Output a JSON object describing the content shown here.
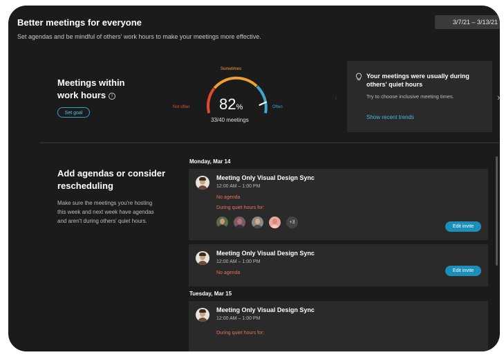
{
  "header": {
    "title": "Better meetings for everyone",
    "subtitle": "Set agendas and be mindful of others' work hours to make your meetings more effective.",
    "date_range": "3/7/21 – 3/13/21"
  },
  "work_hours": {
    "title": "Meetings within work hours",
    "info_icon": "info-icon",
    "set_goal_label": "Set goal",
    "gauge": {
      "percent_value": "82",
      "percent_sign": "%",
      "count_label": "33/40 meetings",
      "label_sometimes": "Sometimes",
      "label_not_often": "Not often",
      "label_often": "Often",
      "value_fraction": 0.825,
      "colors": {
        "not_often": "#e04a2a",
        "sometimes": "#f0a030",
        "often": "#3aa8cc"
      }
    }
  },
  "insight": {
    "title": "Your meetings were usually during others' quiet hours",
    "body": "Try to choose inclusive meeting times.",
    "link": "Show recent trends"
  },
  "agendas": {
    "title": "Add agendas or consider rescheduling",
    "body": "Make sure the meetings you're hosting this week and next week have agendas and aren't during others' quiet hours."
  },
  "days": [
    {
      "label": "Monday, Mar 14",
      "meetings": [
        {
          "title": "Meeting Only Visual Design Sync",
          "time": "12:00 AM – 1:00 PM",
          "warning_agenda": "No agenda",
          "warning_quiet": "During quiet hours for:",
          "more_attendees": "+3",
          "edit_label": "Edit invite"
        },
        {
          "title": "Meeting Only Visual Design Sync",
          "time": "12:00 AM – 1:00 PM",
          "warning_agenda": "No agenda",
          "edit_label": "Edit invite"
        }
      ]
    },
    {
      "label": "Tuesday,  Mar 15",
      "meetings": [
        {
          "title": "Meeting Only Visual Design Sync",
          "time": "12:00 AM – 1:00 PM",
          "warning_quiet": "During quiet hours for:"
        }
      ]
    }
  ],
  "colors": {
    "background": "#1b1b1b",
    "card": "#2a2a2a",
    "accent": "#1b8fb9",
    "warning": "#e8735a"
  }
}
